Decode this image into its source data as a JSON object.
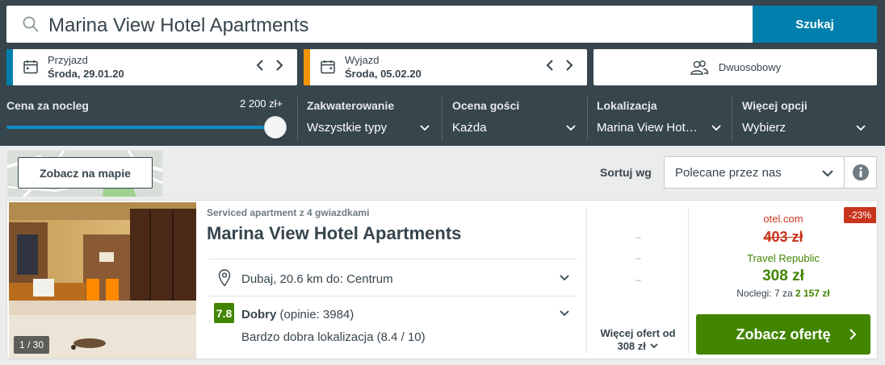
{
  "search": {
    "query": "Marina View Hotel Apartments",
    "button_label": "Szukaj"
  },
  "checkin": {
    "label": "Przyjazd",
    "value": "Środa, 29.01.20",
    "accent": "#007fad"
  },
  "checkout": {
    "label": "Wyjazd",
    "value": "Środa, 05.02.20",
    "accent": "#f39200"
  },
  "room": {
    "label": "Dwuosobowy"
  },
  "filters": {
    "price_label": "Cena za nocleg",
    "price_max": "2 200 zł+",
    "accommodation_label": "Zakwaterowanie",
    "accommodation_value": "Wszystkie typy",
    "rating_label": "Ocena gości",
    "rating_value": "Każda",
    "location_label": "Lokalizacja",
    "location_value": "Marina View Hot…",
    "more_label": "Więcej opcji",
    "more_value": "Wybierz"
  },
  "map": {
    "button_label": "Zobacz na mapie"
  },
  "sort": {
    "label": "Sortuj wg",
    "value": "Polecane przez nas"
  },
  "hotel": {
    "type": "Serviced apartment z 4 gwiazdkami",
    "name": "Marina View Hotel Apartments",
    "location": "Dubaj, 20.6 km do: Centrum",
    "rating_score": "7.8",
    "rating_word": "Dobry",
    "rating_reviews": "(opinie: 3984)",
    "sub_rating": "Bardzo dobra lokalizacja (8.4 / 10)",
    "photo_count": "1 / 30"
  },
  "other_offers": {
    "dashes": [
      "–",
      "–",
      "–"
    ],
    "label_line1": "Więcej ofert od",
    "label_line2": "308 zł"
  },
  "deal": {
    "discount": "-23%",
    "site_old": "otel.com",
    "old_price": "403 zł",
    "site_new": "Travel Republic",
    "new_price": "308 zł",
    "nights_prefix": "Noclegi: 7 za",
    "nights_total": "2 157 zł",
    "button_label": "Zobacz ofertę"
  },
  "colors": {
    "header_bg": "#37454d",
    "primary": "#007fad",
    "deal_green": "#428500",
    "red": "#c7341c"
  }
}
